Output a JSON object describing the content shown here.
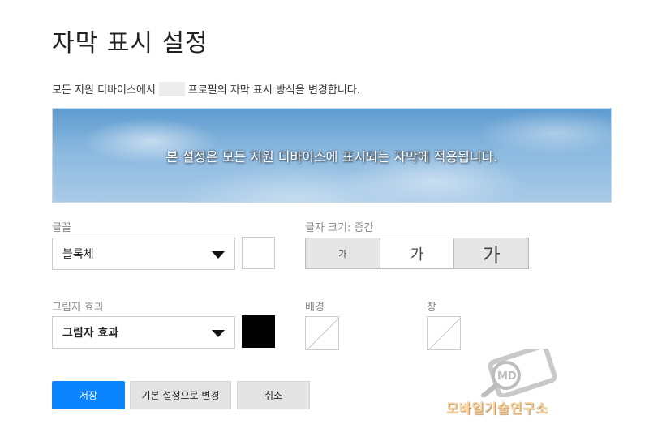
{
  "page": {
    "title": "자막 표시 설정",
    "description_before": "모든 지원 디바이스에서",
    "description_after": "프로필의 자막 표시 방식을 변경합니다."
  },
  "preview": {
    "text": "본 설정은 모든 지원 디바이스에 표시되는 자막에 적용됩니다."
  },
  "font": {
    "label": "글꼴",
    "selected": "블록체",
    "color": "#ffffff"
  },
  "text_size": {
    "label": "글자 크기: 중간",
    "options": [
      "가",
      "가",
      "가"
    ],
    "selected_index": 1
  },
  "shadow": {
    "label": "그림자 효과",
    "selected": "그림자 효과",
    "color": "#000000"
  },
  "background": {
    "label": "배경"
  },
  "window": {
    "label": "창"
  },
  "buttons": {
    "save": "저장",
    "reset": "기본 설정으로 변경",
    "cancel": "취소"
  },
  "watermark": {
    "logo_text": "MD",
    "text": "모바일기술연구소"
  },
  "colors": {
    "primary": "#0a84ff"
  }
}
